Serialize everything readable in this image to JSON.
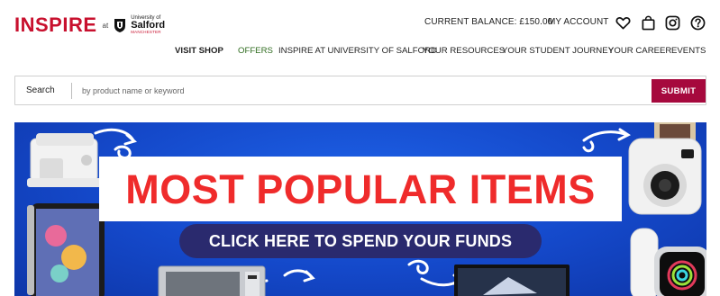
{
  "brand": {
    "name": "INSPIRE",
    "at": "at",
    "university_small": "University of",
    "university_name": "Salford",
    "university_city": "MANCHESTER",
    "accent_color": "#c8102e"
  },
  "header": {
    "balance": "CURRENT BALANCE: £150.00",
    "account": "MY ACCOUNT",
    "icons": [
      "heart-icon",
      "shopping-bag-icon",
      "instagram-icon",
      "help-icon"
    ]
  },
  "nav": {
    "items": [
      "VISIT SHOP",
      "OFFERS",
      "INSPIRE AT UNIVERSITY OF SALFORD",
      "YOUR RESOURCES",
      "YOUR STUDENT JOURNEY",
      "YOUR CAREER",
      "EVENTS"
    ]
  },
  "search": {
    "label": "Search",
    "placeholder": "by product name or keyword",
    "value": "",
    "submit": "SUBMIT",
    "submit_color": "#a6093d"
  },
  "banner": {
    "headline": "MOST POPULAR ITEMS",
    "cta": "CLICK HERE TO SPEND YOUR FUNDS",
    "background_color": "#1448c9",
    "headline_color": "#ef2b2b",
    "cta_color": "#2a2a6e",
    "product_icons": [
      "sewing-machine-icon",
      "tablet-icon",
      "microwave-icon",
      "monitor-icon",
      "instant-camera-icon",
      "smartwatch-icon"
    ]
  }
}
